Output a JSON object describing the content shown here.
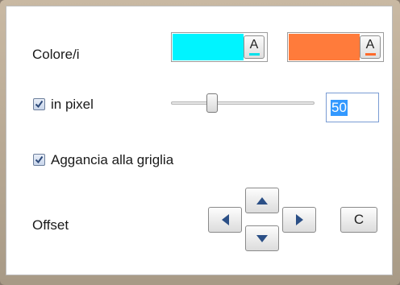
{
  "colors": {
    "label": "Colore/i",
    "swatch1": {
      "color": "#00f4ff",
      "button_label": "A",
      "underline_color": "#00e0ea"
    },
    "swatch2": {
      "color": "#ff7b3b",
      "button_label": "A",
      "underline_color": "#ff6a2a"
    }
  },
  "pixel": {
    "checkbox_label": "in pixel",
    "checked": true,
    "slider_level": 0.27,
    "value": "50"
  },
  "snap": {
    "checkbox_label": "Aggancia alla griglia",
    "checked": true
  },
  "offset": {
    "label": "Offset",
    "up_icon": "triangle-up",
    "down_icon": "triangle-down",
    "left_icon": "triangle-left",
    "right_icon": "triangle-right",
    "center_label": "C"
  }
}
